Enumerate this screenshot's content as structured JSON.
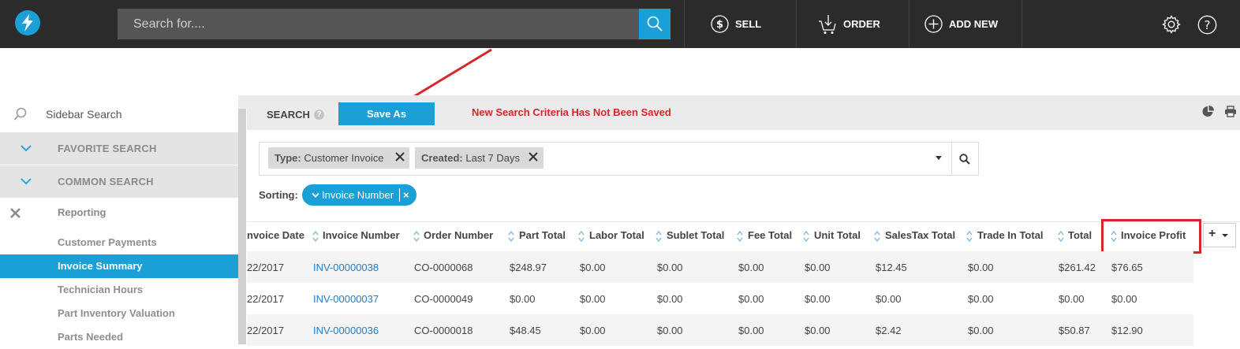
{
  "topbar": {
    "search_placeholder": "Search for....",
    "sell_label": "SELL",
    "order_label": "ORDER",
    "add_new_label": "ADD NEW"
  },
  "sidebar": {
    "search_label": "Sidebar Search",
    "favorite_label": "FAVORITE SEARCH",
    "common_label": "COMMON SEARCH",
    "reporting_label": "Reporting",
    "items": [
      {
        "label": "Customer Payments"
      },
      {
        "label": "Invoice Summary",
        "active": true
      },
      {
        "label": "Technician Hours"
      },
      {
        "label": "Part Inventory Valuation"
      },
      {
        "label": "Parts Needed"
      }
    ]
  },
  "toolbar": {
    "search_label": "SEARCH",
    "help": "?",
    "save_as_label": "Save As",
    "warning": "New Search Criteria Has Not Been Saved"
  },
  "filters": [
    {
      "key": "Type:",
      "value": "Customer Invoice"
    },
    {
      "key": "Created:",
      "value": "Last 7 Days"
    }
  ],
  "sorting": {
    "label": "Sorting:",
    "value": "Invoice Number",
    "remove": "×"
  },
  "table": {
    "columns": [
      "nvoice Date",
      "Invoice Number",
      "Order Number",
      "Part Total",
      "Labor Total",
      "Sublet Total",
      "Fee Total",
      "Unit Total",
      "SalesTax Total",
      "Trade In Total",
      "Total",
      "Invoice Profit"
    ],
    "rows": [
      [
        "22/2017",
        "INV-00000038",
        "CO-0000068",
        "$248.97",
        "$0.00",
        "$0.00",
        "$0.00",
        "$0.00",
        "$12.45",
        "$0.00",
        "$261.42",
        "$76.65"
      ],
      [
        "22/2017",
        "INV-00000037",
        "CO-0000049",
        "$0.00",
        "$0.00",
        "$0.00",
        "$0.00",
        "$0.00",
        "$0.00",
        "$0.00",
        "$0.00",
        "$0.00"
      ],
      [
        "22/2017",
        "INV-00000036",
        "CO-0000018",
        "$48.45",
        "$0.00",
        "$0.00",
        "$0.00",
        "$0.00",
        "$2.42",
        "$0.00",
        "$50.87",
        "$12.90"
      ]
    ],
    "add_column": "+"
  },
  "colors": {
    "accent": "#1a9fd6",
    "topbar": "#2b2b2b",
    "warning": "#d9252a",
    "link": "#2a7bbf"
  }
}
